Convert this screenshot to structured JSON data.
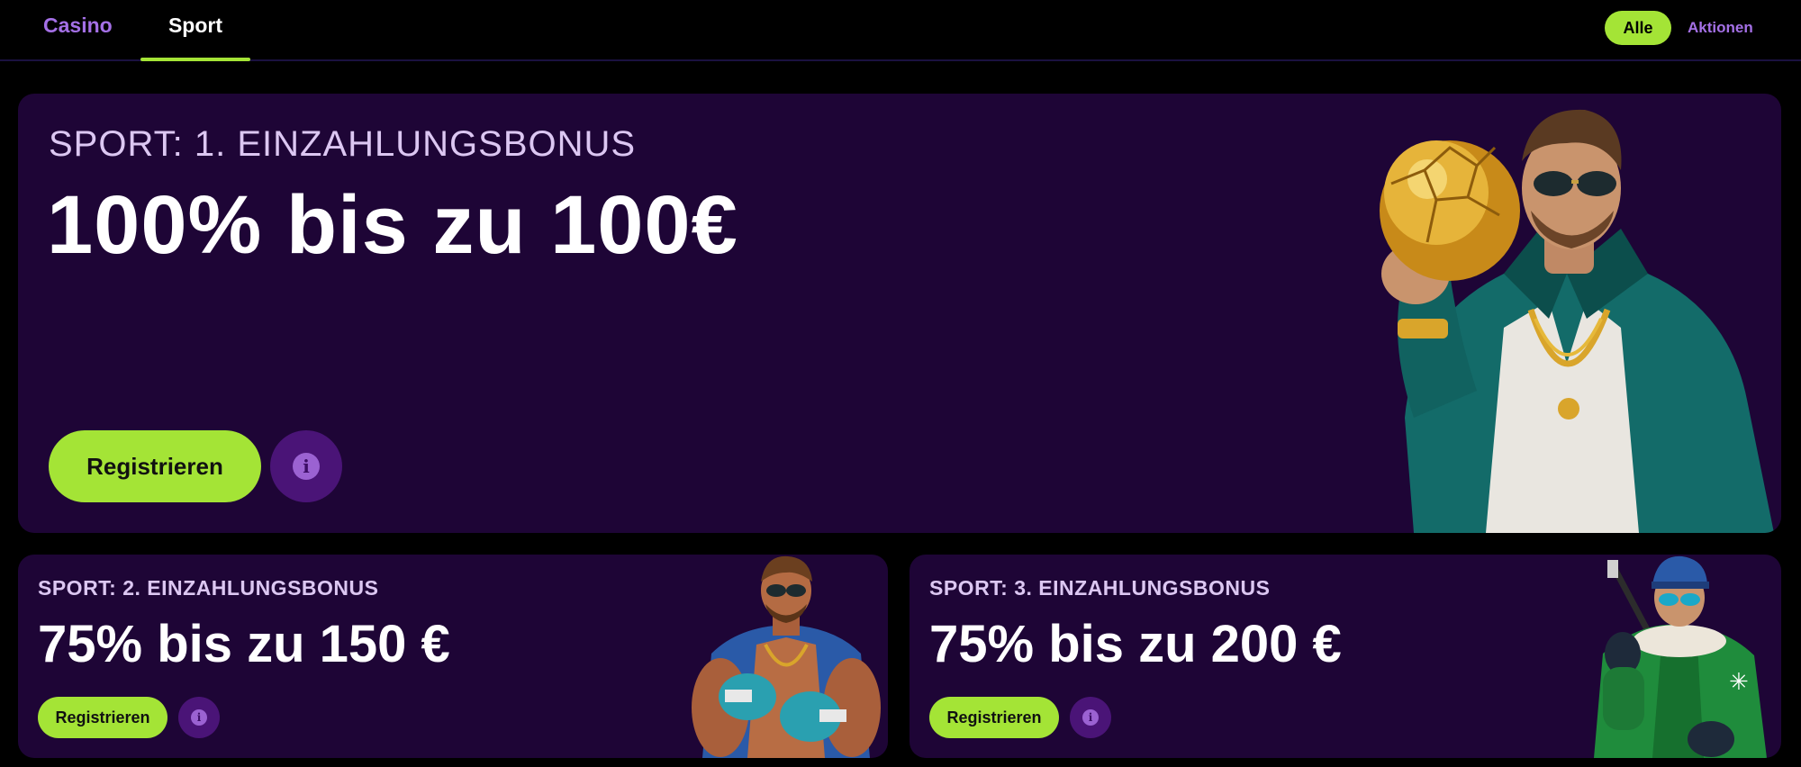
{
  "nav": {
    "tabs": [
      {
        "label": "Casino",
        "active": false
      },
      {
        "label": "Sport",
        "active": true
      }
    ],
    "filter_all": "Alle",
    "filter_promos": "Aktionen"
  },
  "colors": {
    "accent_green": "#a4e436",
    "card_bg": "#1e0536",
    "muted_purple": "#a470e6"
  },
  "promos": [
    {
      "eyebrow": "SPORT: 1. EINZAHLUNGSBONUS",
      "headline": "100% bis zu 100€",
      "cta": "Registrieren",
      "info_glyph": "i",
      "art": "footballer-golden-ball-illustration"
    },
    {
      "eyebrow": "SPORT: 2. EINZAHLUNGSBONUS",
      "headline": "75% bis zu 150 €",
      "cta": "Registrieren",
      "info_glyph": "i",
      "art": "boxer-illustration"
    },
    {
      "eyebrow": "SPORT: 3. EINZAHLUNGSBONUS",
      "headline": "75% bis zu 200 €",
      "cta": "Registrieren",
      "info_glyph": "i",
      "art": "hockey-player-illustration"
    }
  ]
}
